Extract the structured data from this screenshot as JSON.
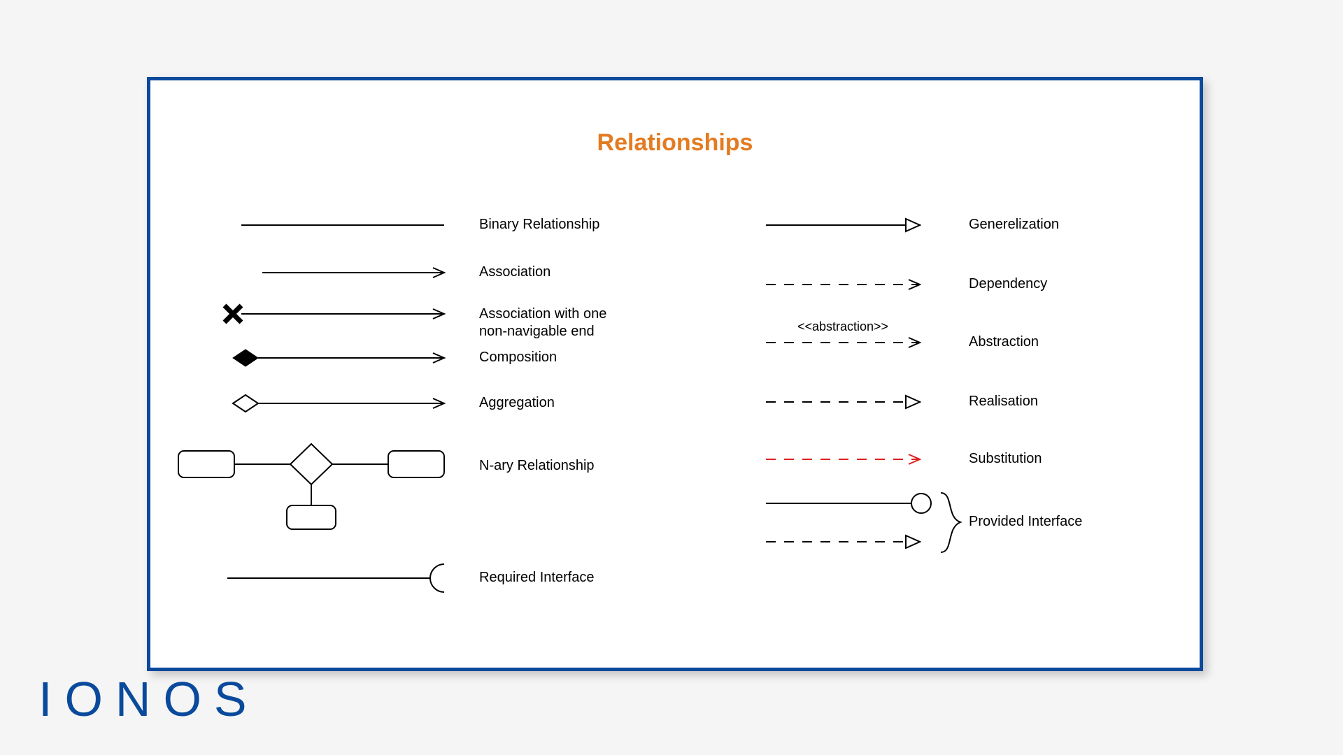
{
  "title": "Relationships",
  "logo": "IONOS",
  "left": {
    "binary": "Binary Relationship",
    "association": "Association",
    "assoc_nonnav_1": "Association with one",
    "assoc_nonnav_2": "non-navigable end",
    "composition": "Composition",
    "aggregation": "Aggregation",
    "nary": "N-ary Relationship",
    "required": "Required Interface"
  },
  "right": {
    "generalization": "Generelization",
    "dependency": "Dependency",
    "abstraction_stereo": "<<abstraction>>",
    "abstraction": "Abstraction",
    "realisation": "Realisation",
    "substitution": "Substitution",
    "provided": "Provided Interface"
  }
}
